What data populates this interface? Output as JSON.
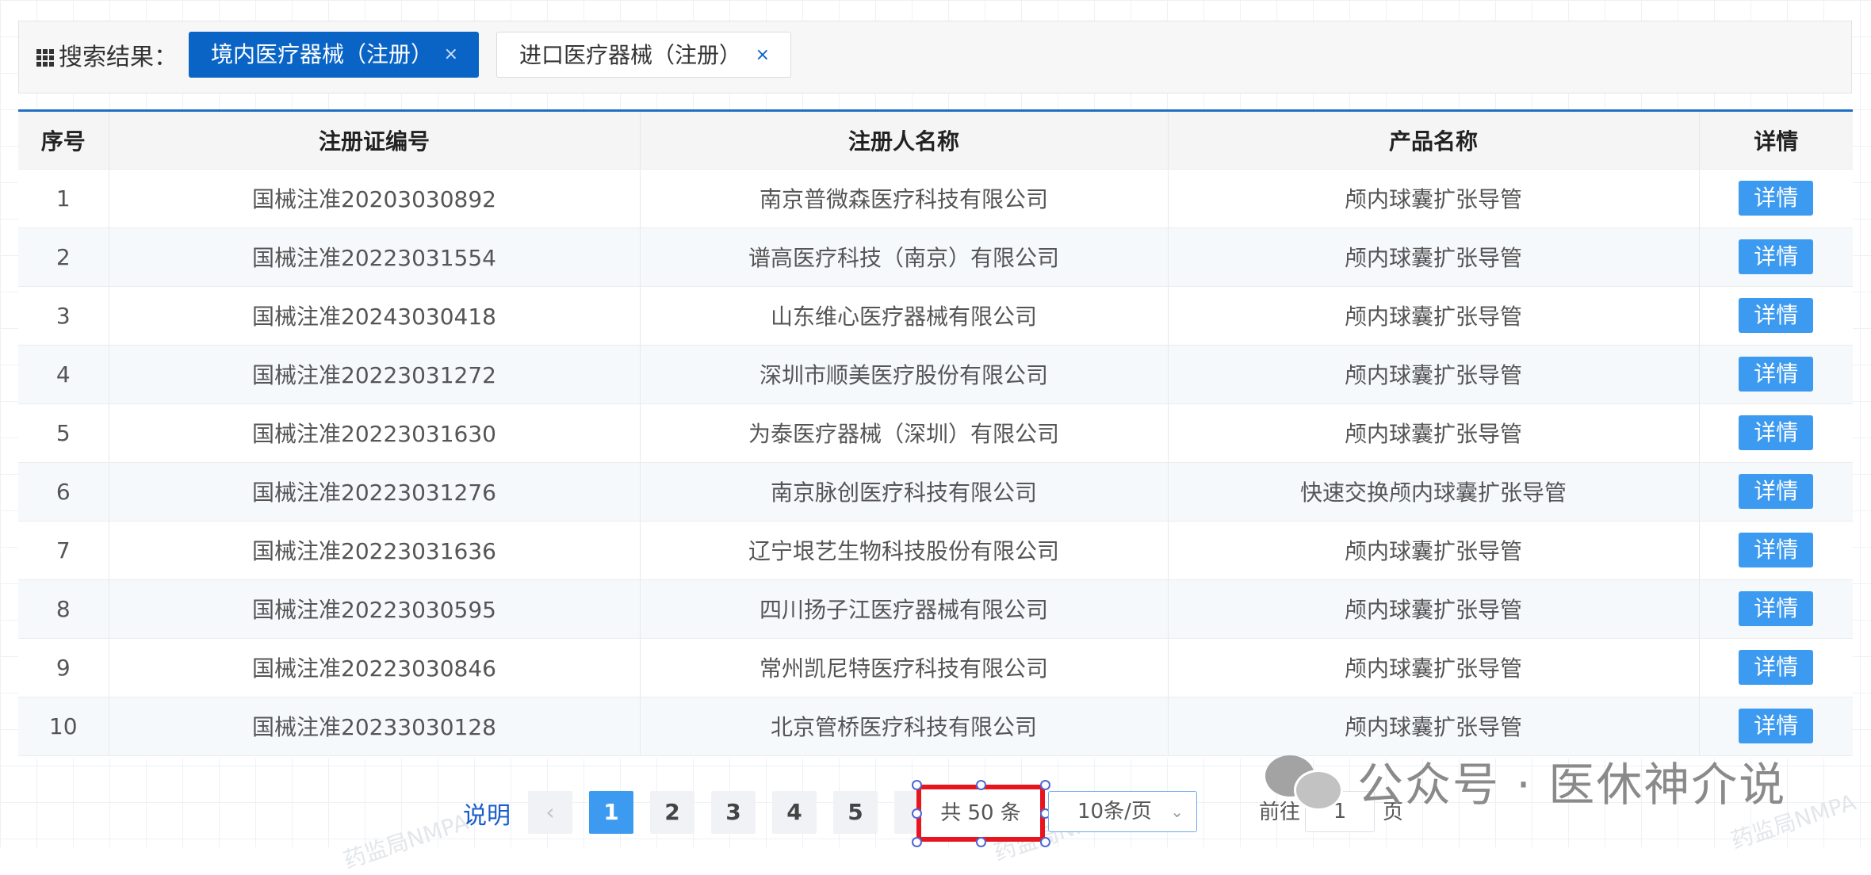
{
  "search": {
    "label": "搜索结果：",
    "tags": [
      {
        "label": "境内医疗器械（注册）",
        "close": "×"
      },
      {
        "label": "进口医疗器械（注册）",
        "close": "×"
      }
    ]
  },
  "table": {
    "headers": [
      "序号",
      "注册证编号",
      "注册人名称",
      "产品名称",
      "详情"
    ],
    "rows": [
      {
        "no": "1",
        "reg": "国械注准20203030892",
        "company": "南京普微森医疗科技有限公司",
        "product": "颅内球囊扩张导管",
        "detail": "详情"
      },
      {
        "no": "2",
        "reg": "国械注准20223031554",
        "company": "谱高医疗科技（南京）有限公司",
        "product": "颅内球囊扩张导管",
        "detail": "详情"
      },
      {
        "no": "3",
        "reg": "国械注准20243030418",
        "company": "山东维心医疗器械有限公司",
        "product": "颅内球囊扩张导管",
        "detail": "详情"
      },
      {
        "no": "4",
        "reg": "国械注准20223031272",
        "company": "深圳市顺美医疗股份有限公司",
        "product": "颅内球囊扩张导管",
        "detail": "详情"
      },
      {
        "no": "5",
        "reg": "国械注准20223031630",
        "company": "为泰医疗器械（深圳）有限公司",
        "product": "颅内球囊扩张导管",
        "detail": "详情"
      },
      {
        "no": "6",
        "reg": "国械注准20223031276",
        "company": "南京脉创医疗科技有限公司",
        "product": "快速交换颅内球囊扩张导管",
        "detail": "详情"
      },
      {
        "no": "7",
        "reg": "国械注准20223031636",
        "company": "辽宁垠艺生物科技股份有限公司",
        "product": "颅内球囊扩张导管",
        "detail": "详情"
      },
      {
        "no": "8",
        "reg": "国械注准20223030595",
        "company": "四川扬子江医疗器械有限公司",
        "product": "颅内球囊扩张导管",
        "detail": "详情"
      },
      {
        "no": "9",
        "reg": "国械注准20223030846",
        "company": "常州凯尼特医疗科技有限公司",
        "product": "颅内球囊扩张导管",
        "detail": "详情"
      },
      {
        "no": "10",
        "reg": "国械注准20233030128",
        "company": "北京管桥医疗科技有限公司",
        "product": "颅内球囊扩张导管",
        "detail": "详情"
      }
    ]
  },
  "pagination": {
    "explain": "说明",
    "prev": "‹",
    "pages": [
      "1",
      "2",
      "3",
      "4",
      "5"
    ],
    "current_page": "1",
    "total": "共 50 条",
    "page_size": "10条/页",
    "goto_label": "前往",
    "goto_value": "1",
    "page_suffix": "页"
  },
  "watermarks": {
    "nmpa": "药监局NMPA",
    "wechat": "公众号 · 医休神介说"
  },
  "colors": {
    "accent": "#0a64c6",
    "button": "#3c9af0",
    "highlight_border": "#e8151f"
  }
}
